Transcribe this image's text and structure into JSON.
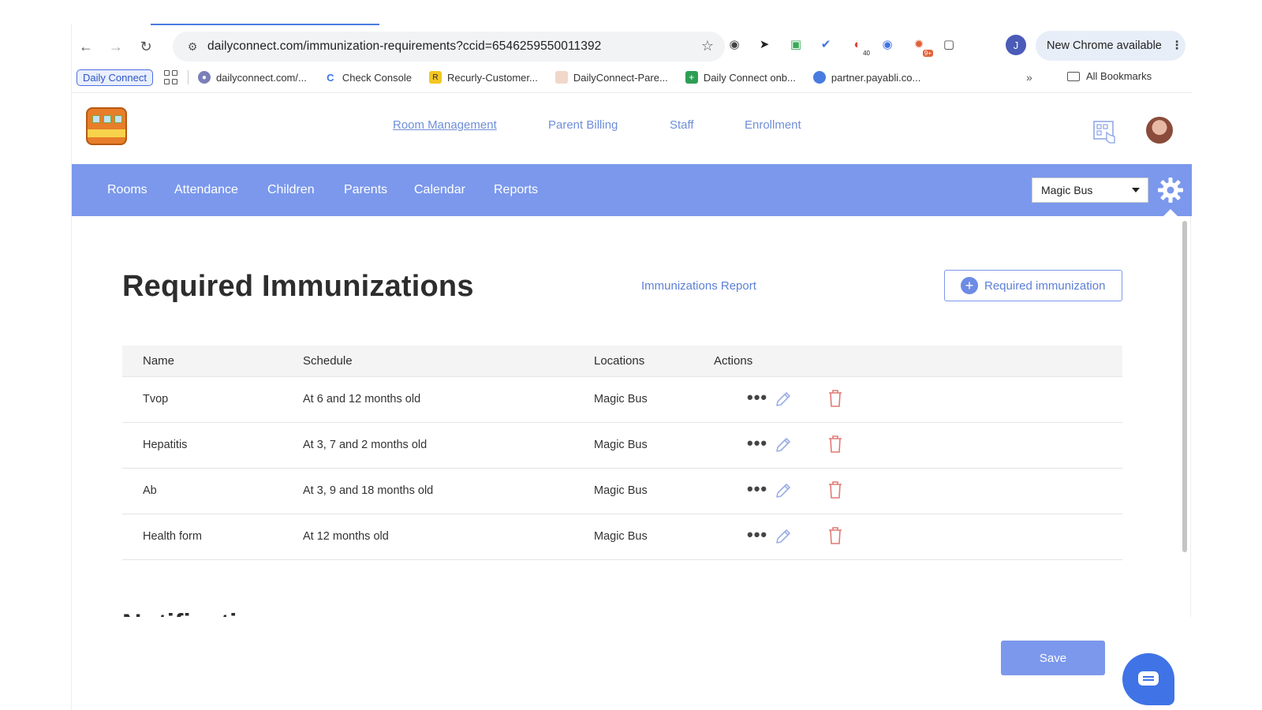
{
  "browser": {
    "url": "dailyconnect.com/immunization-requirements?ccid=6546259550011392",
    "new_chrome_label": "New Chrome available",
    "profile_initial": "J",
    "ext_badge_1": "40",
    "ext_badge_2": "9+",
    "bookmarks": [
      {
        "label": "Daily Connect"
      },
      {
        "label": "dailyconnect.com/..."
      },
      {
        "label": "Check Console"
      },
      {
        "label": "Recurly-Customer..."
      },
      {
        "label": "DailyConnect-Pare..."
      },
      {
        "label": "Daily Connect onb..."
      },
      {
        "label": "partner.payabli.co..."
      }
    ],
    "more_label": "»",
    "all_bookmarks": "All Bookmarks"
  },
  "header": {
    "links": [
      "Room Management",
      "Parent Billing",
      "Staff",
      "Enrollment"
    ]
  },
  "nav": {
    "items": [
      "Rooms",
      "Attendance",
      "Children",
      "Parents",
      "Calendar",
      "Reports"
    ],
    "location_selected": "Magic Bus",
    "accent": "#7b98ec"
  },
  "page": {
    "title": "Required Immunizations",
    "report_link": "Immunizations Report",
    "add_button": "Required immunization"
  },
  "table": {
    "headers": [
      "Name",
      "Schedule",
      "Locations",
      "Actions"
    ],
    "rows": [
      {
        "name": "Tvop",
        "schedule": "At 6 and 12 months old",
        "location": "Magic Bus"
      },
      {
        "name": "Hepatitis",
        "schedule": "At 3, 7 and 2 months old",
        "location": "Magic Bus"
      },
      {
        "name": "Ab",
        "schedule": "At 3, 9 and 18 months old",
        "location": "Magic Bus"
      },
      {
        "name": "Health form",
        "schedule": "At 12 months old",
        "location": "Magic Bus"
      }
    ],
    "more_glyph": "•••"
  },
  "notifications": {
    "title": "Notifications"
  },
  "footer": {
    "save_label": "Save"
  }
}
